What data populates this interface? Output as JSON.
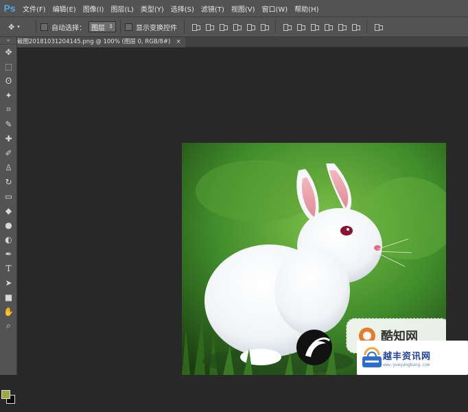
{
  "app": {
    "logo": "Ps"
  },
  "menu": [
    "文件(F)",
    "编辑(E)",
    "图像(I)",
    "图层(L)",
    "类型(Y)",
    "选择(S)",
    "滤镜(T)",
    "视图(V)",
    "窗口(W)",
    "帮助(H)"
  ],
  "options": {
    "auto_select_label": "自动选择：",
    "auto_select_value": "图层",
    "show_transform_label": "显示变换控件"
  },
  "document": {
    "tab_title": "截图20181031204145.png @ 100% (图层 0, RGB/8#)",
    "close": "×"
  },
  "tools": [
    "move-icon",
    "marquee-icon",
    "lasso-icon",
    "magic-wand-icon",
    "crop-icon",
    "eyedropper-icon",
    "healing-icon",
    "brush-icon",
    "stamp-icon",
    "history-brush-icon",
    "eraser-icon",
    "bucket-icon",
    "blur-icon",
    "dodge-icon",
    "pen-icon",
    "type-icon",
    "path-select-icon",
    "shape-icon",
    "hand-icon",
    "zoom-icon"
  ],
  "tool_glyphs": [
    "✥",
    "⬚",
    "ʘ",
    "✦",
    "⌗",
    "✎",
    "✚",
    "✐",
    "♙",
    "↻",
    "▭",
    "◆",
    "●",
    "◐",
    "✒",
    "T",
    "➤",
    "■",
    "✋",
    "⌕"
  ],
  "colors": {
    "foreground": "#9da742",
    "background": "#0b0b0b"
  },
  "watermark_a": {
    "text": "酷知网"
  },
  "watermark_b": {
    "title": "越丰资讯网",
    "url": "www.yueyangbang.com"
  }
}
